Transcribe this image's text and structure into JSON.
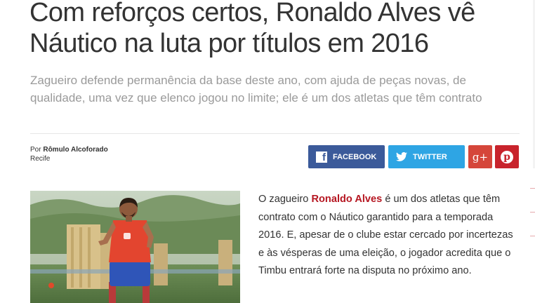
{
  "article": {
    "title": "Com reforços certos, Ronaldo Alves vê Náutico na luta por títulos em 2016",
    "subtitle": "Zagueiro defende permanência da base deste ano, com ajuda de peças novas, de qualidade, uma vez que elenco jogou no limite; ele é um dos atletas que têm contrato",
    "author_prefix": "Por",
    "author_name": "Rômulo Alcoforado",
    "city": "Recife",
    "body_pre": "O zagueiro ",
    "body_highlight": "Ronaldo Alves",
    "body_post": " é um dos atletas que têm contrato com o Náutico garantido para a temporada 2016. E, apesar de o clube estar cercado por incertezas e às vésperas de uma eleição, o jogador acredita que o Timbu entrará forte na disputa no próximo ano."
  },
  "share": {
    "facebook_label": "FACEBOOK",
    "twitter_label": "TWITTER",
    "gplus_label": "g+",
    "pinterest_label": "p"
  },
  "colors": {
    "facebook": "#3b5a9a",
    "twitter": "#2ea5e4",
    "gplus": "#d5463a",
    "pinterest": "#c8232c",
    "highlight": "#b61722"
  },
  "icons": [
    "facebook-icon",
    "twitter-icon",
    "google-plus-icon",
    "pinterest-icon"
  ]
}
